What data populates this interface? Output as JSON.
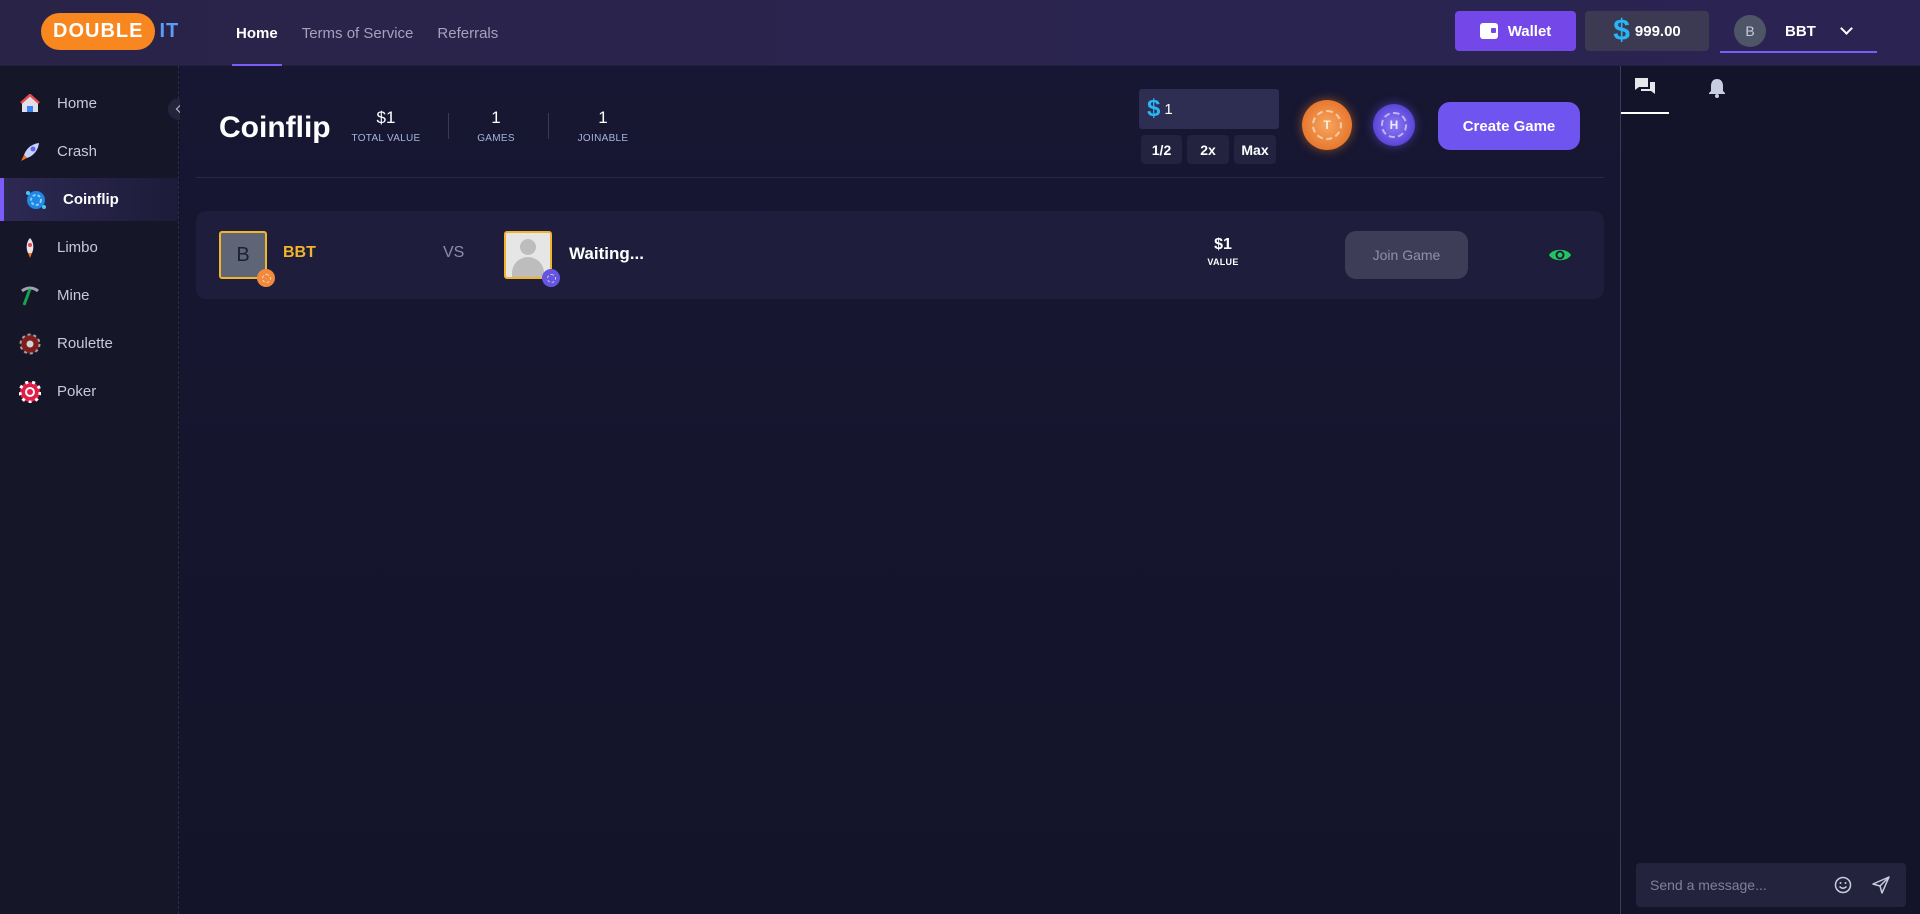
{
  "brand": {
    "logo_main": "DOUBLE",
    "logo_suffix": "IT"
  },
  "topnav": [
    {
      "label": "Home",
      "active": true
    },
    {
      "label": "Terms of Service",
      "active": false
    },
    {
      "label": "Referrals",
      "active": false
    }
  ],
  "header": {
    "wallet_label": "Wallet",
    "balance_symbol": "$",
    "balance": "999.00",
    "user_initial": "B",
    "username": "BBT"
  },
  "sidebar": {
    "items": [
      {
        "label": "Home",
        "icon": "house-icon",
        "active": false
      },
      {
        "label": "Crash",
        "icon": "rocket-icon",
        "active": false
      },
      {
        "label": "Coinflip",
        "icon": "coinflip-icon",
        "active": true
      },
      {
        "label": "Limbo",
        "icon": "limbo-rocket-icon",
        "active": false
      },
      {
        "label": "Mine",
        "icon": "pickaxe-icon",
        "active": false
      },
      {
        "label": "Roulette",
        "icon": "roulette-icon",
        "active": false
      },
      {
        "label": "Poker",
        "icon": "poker-chip-icon",
        "active": false
      }
    ]
  },
  "coinflip": {
    "title": "Coinflip",
    "stats": [
      {
        "value": "$1",
        "label": "TOTAL VALUE"
      },
      {
        "value": "1",
        "label": "GAMES"
      },
      {
        "value": "1",
        "label": "JOINABLE"
      }
    ],
    "bet": {
      "symbol": "$",
      "value": "1"
    },
    "quick_buttons": [
      "1/2",
      "2x",
      "Max"
    ],
    "coins": {
      "tails": "T",
      "heads": "H"
    },
    "create_label": "Create Game"
  },
  "games": [
    {
      "player_initial": "B",
      "player_name": "BBT",
      "vs": "VS",
      "opponent": "Waiting...",
      "value": "$1",
      "value_label": "VALUE",
      "join_label": "Join Game"
    }
  ],
  "chat": {
    "placeholder": "Send a message..."
  },
  "colors": {
    "accent": "#7c5cf6",
    "brand_orange": "#f7871e",
    "gold": "#f2b42a",
    "cyan": "#29b6f6",
    "eye_green": "#22c55e"
  }
}
